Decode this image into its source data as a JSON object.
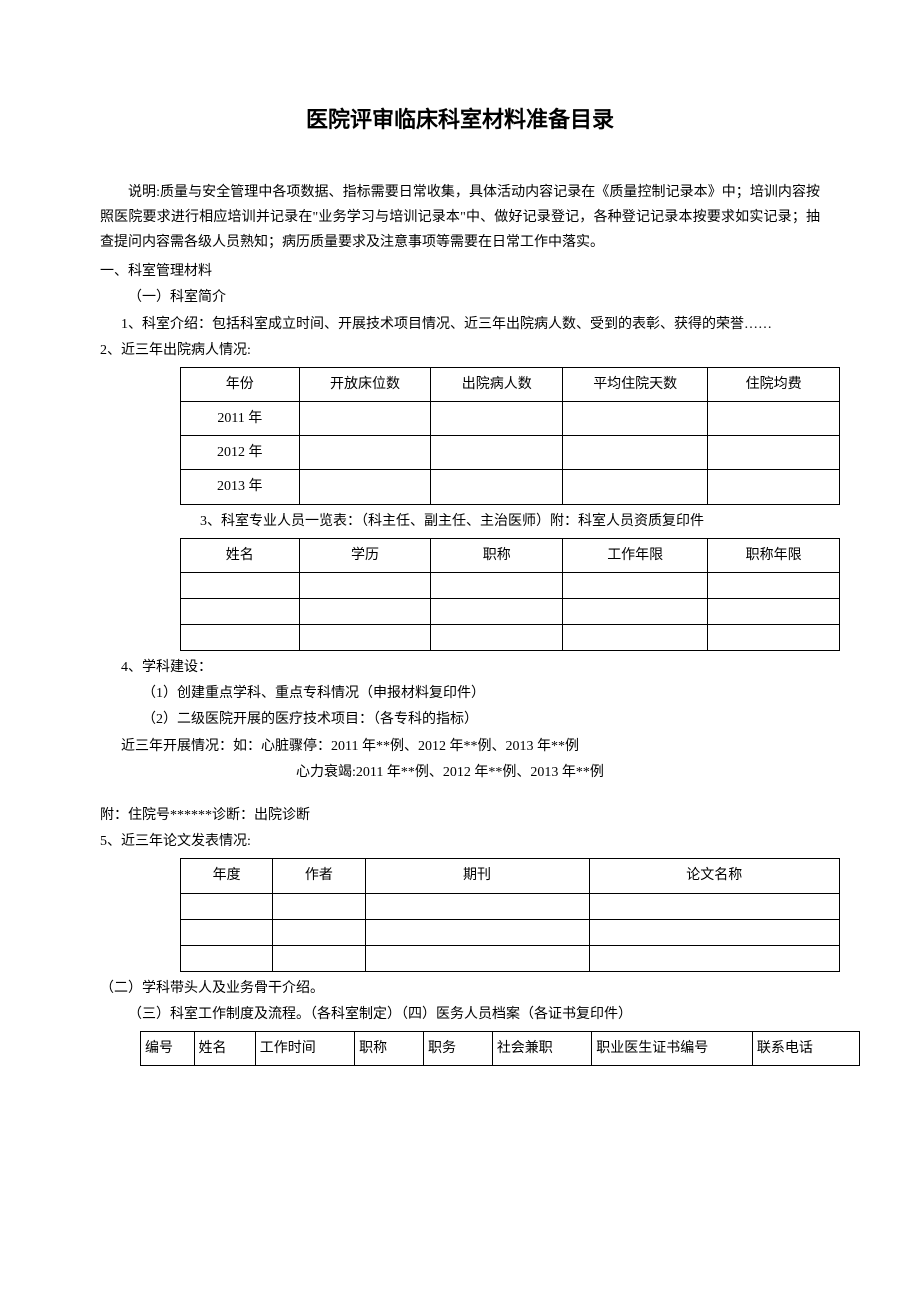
{
  "title": "医院评审临床科室材料准备目录",
  "intro": "说明:质量与安全管理中各项数据、指标需要日常收集，具体活动内容记录在《质量控制记录本》中；培训内容按照医院要求进行相应培训并记录在\"业务学习与培训记录本\"中、做好记录登记，各种登记记录本按要求如实记录；抽查提问内容需各级人员熟知；病历质量要求及注意事项等需要在日常工作中落实。",
  "s1": {
    "heading": "一、科室管理材料",
    "sub1": "（一）科室简介",
    "item1": "1、科室介绍：包括科室成立时间、开展技术项目情况、近三年出院病人数、受到的表彰、获得的荣誉……",
    "item2": "2、近三年出院病人情况:",
    "table1": {
      "headers": [
        "年份",
        "开放床位数",
        "出院病人数",
        "平均住院天数",
        "住院均费"
      ],
      "rows": [
        [
          "2011 年",
          "",
          "",
          "",
          ""
        ],
        [
          "2012 年",
          "",
          "",
          "",
          ""
        ],
        [
          "2013 年",
          "",
          "",
          "",
          ""
        ]
      ]
    },
    "item3": "3、科室专业人员一览表：（科主任、副主任、主治医师）附：科室人员资质复印件",
    "table2": {
      "headers": [
        "姓名",
        "学历",
        "职称",
        "工作年限",
        "职称年限"
      ],
      "rows": [
        [
          "",
          "",
          "",
          "",
          ""
        ],
        [
          "",
          "",
          "",
          "",
          ""
        ],
        [
          "",
          "",
          "",
          "",
          ""
        ]
      ]
    },
    "item4": "4、学科建设：",
    "item4_1": "（1）创建重点学科、重点专科情况（申报材料复印件）",
    "item4_2": "（2）二级医院开展的医疗技术项目：（各专科的指标）",
    "item4_3": "近三年开展情况：如：心脏骤停：2011 年**例、2012 年**例、2013 年**例",
    "item4_4": "心力衰竭:2011 年**例、2012 年**例、2013 年**例",
    "appendix": "附：住院号******诊断：出院诊断",
    "item5": "5、近三年论文发表情况:",
    "table3": {
      "headers": [
        "年度",
        "作者",
        "期刊",
        "论文名称"
      ],
      "rows": [
        [
          "",
          "",
          "",
          ""
        ],
        [
          "",
          "",
          "",
          ""
        ],
        [
          "",
          "",
          "",
          ""
        ]
      ]
    },
    "sub2": "（二）学科带头人及业务骨干介绍。",
    "sub3": "（三）科室工作制度及流程。（各科室制定）（四）医务人员档案（各证书复印件）",
    "table4": {
      "headers": [
        "编号",
        "姓名",
        "工作时间",
        "职称",
        "职务",
        "社会兼职",
        "职业医生证书编号",
        "联系电话"
      ]
    }
  }
}
